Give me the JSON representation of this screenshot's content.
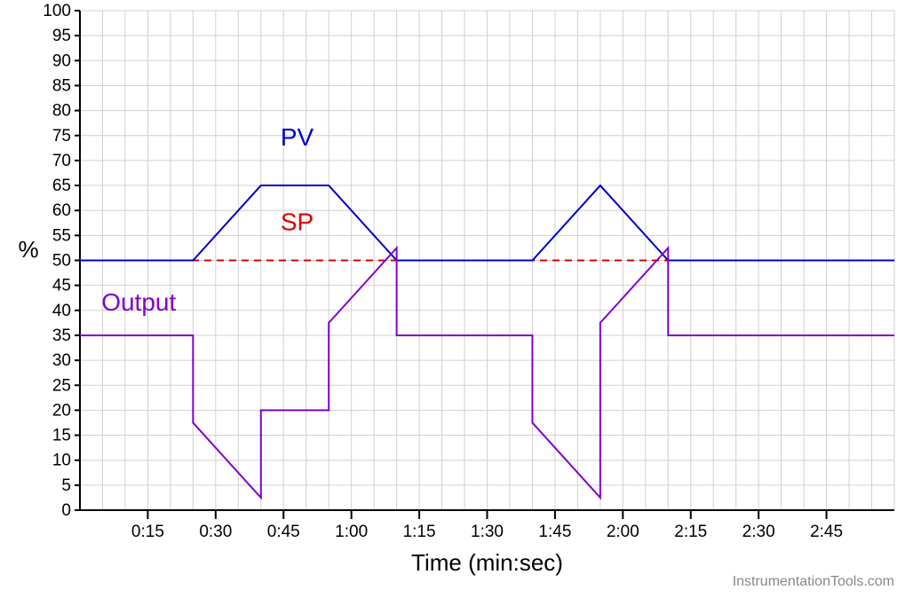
{
  "chart_data": {
    "type": "line",
    "xlabel": "Time  (min:sec)",
    "ylabel": "%",
    "ylim": [
      0,
      100
    ],
    "y_ticks": [
      0,
      5,
      10,
      15,
      20,
      25,
      30,
      35,
      40,
      45,
      50,
      55,
      60,
      65,
      70,
      75,
      80,
      85,
      90,
      95,
      100
    ],
    "x_ticks": [
      "0:15",
      "0:30",
      "0:45",
      "1:00",
      "1:15",
      "1:30",
      "1:45",
      "2:00",
      "2:15",
      "2:30",
      "2:45"
    ],
    "x_range_sec": [
      0,
      180
    ],
    "series": [
      {
        "name": "PV",
        "color": "#0000cc",
        "points_sec_val": [
          [
            0,
            50
          ],
          [
            25,
            50
          ],
          [
            40,
            65
          ],
          [
            55,
            65
          ],
          [
            70,
            50
          ],
          [
            100,
            50
          ],
          [
            115,
            65
          ],
          [
            130,
            50
          ],
          [
            180,
            50
          ]
        ]
      },
      {
        "name": "SP",
        "color": "#dd0000",
        "dashed": true,
        "points_sec_val": [
          [
            0,
            50
          ],
          [
            180,
            50
          ]
        ]
      },
      {
        "name": "Output",
        "color": "#8000d0",
        "points_sec_val": [
          [
            0,
            35
          ],
          [
            25,
            35
          ],
          [
            25,
            17.5
          ],
          [
            40,
            2.5
          ],
          [
            40,
            20
          ],
          [
            55,
            20
          ],
          [
            55,
            37.5
          ],
          [
            70,
            52.5
          ],
          [
            70,
            35
          ],
          [
            100,
            35
          ],
          [
            100,
            17.5
          ],
          [
            115,
            2.5
          ],
          [
            115,
            37.5
          ],
          [
            130,
            52.5
          ],
          [
            130,
            35
          ],
          [
            180,
            35
          ]
        ]
      }
    ],
    "annotations": [
      {
        "text": "PV",
        "x_sec": 48,
        "y_val": 73,
        "color": "#0000cc"
      },
      {
        "text": "SP",
        "x_sec": 48,
        "y_val": 56,
        "color": "#dd0000"
      },
      {
        "text": "Output",
        "x_sec": 13,
        "y_val": 40,
        "color": "#8000d0"
      }
    ]
  },
  "watermark": "InstrumentationTools.com"
}
